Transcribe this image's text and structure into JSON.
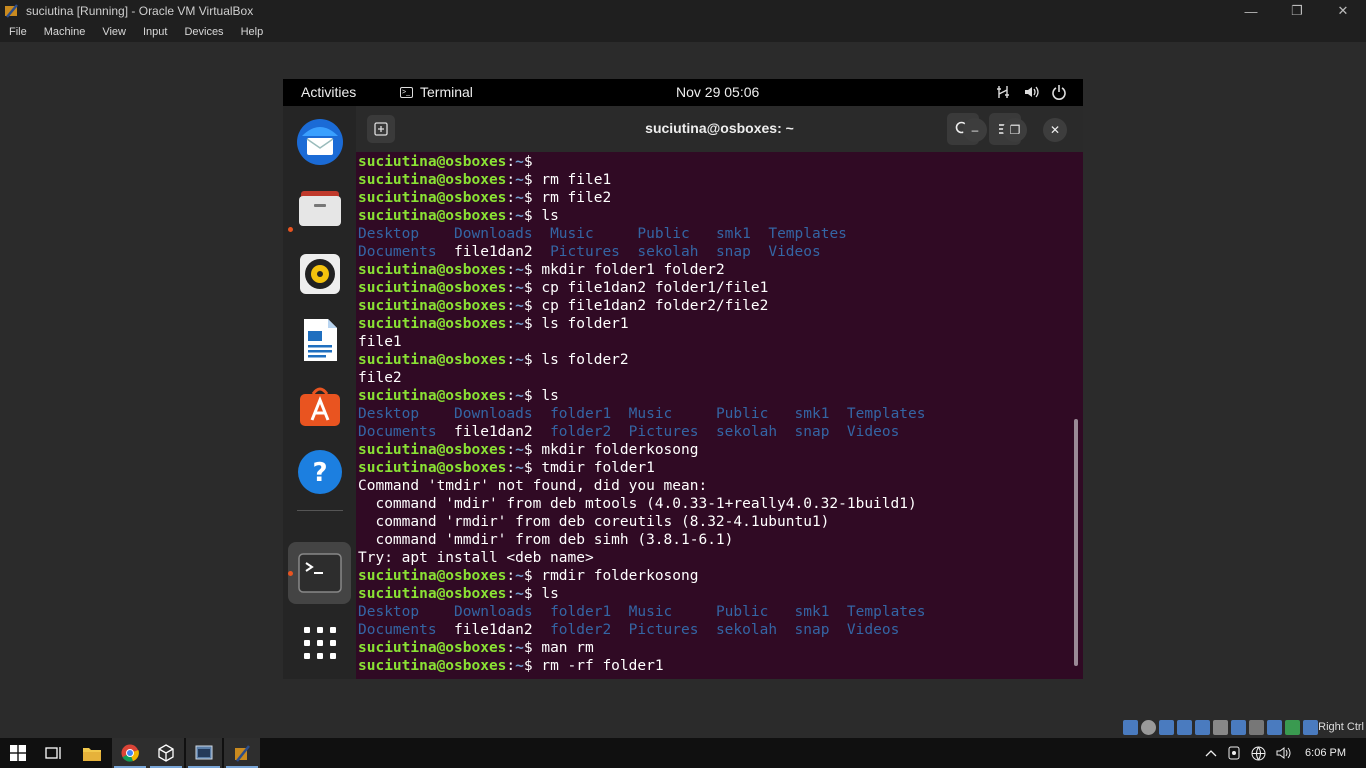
{
  "host_window": {
    "title": "suciutina [Running] - Oracle VM VirtualBox",
    "controls": [
      "minimize-icon",
      "restore-icon",
      "close-icon"
    ]
  },
  "menubar": [
    "File",
    "Machine",
    "View",
    "Input",
    "Devices",
    "Help"
  ],
  "gnome_topbar": {
    "activities": "Activities",
    "app_name": "Terminal",
    "clock": "Nov 29  05:06",
    "tray_icons": [
      "network-icon",
      "volume-icon",
      "power-icon"
    ]
  },
  "dock": {
    "items": [
      {
        "name": "thunderbird",
        "icon": "mail-client-icon"
      },
      {
        "name": "files",
        "icon": "file-manager-icon",
        "running": true
      },
      {
        "name": "rhythmbox",
        "icon": "music-player-icon"
      },
      {
        "name": "libreoffice-writer",
        "icon": "document-editor-icon"
      },
      {
        "name": "ubuntu-software",
        "icon": "app-store-icon"
      },
      {
        "name": "help",
        "icon": "help-icon"
      },
      {
        "name": "terminal",
        "icon": "terminal-icon",
        "running": true,
        "active": true
      },
      {
        "name": "show-applications",
        "icon": "app-grid-icon"
      }
    ]
  },
  "terminal": {
    "title": "suciutina@osboxes: ~",
    "prompt_user": "suciutina@osboxes",
    "prompt_path": "~",
    "lines": [
      {
        "t": "prompt",
        "cmd": ""
      },
      {
        "t": "prompt",
        "cmd": "rm file1"
      },
      {
        "t": "prompt",
        "cmd": "rm file2"
      },
      {
        "t": "prompt",
        "cmd": "ls"
      },
      {
        "t": "ls",
        "items": [
          [
            "Desktop",
            "dir"
          ],
          [
            "Downloads",
            "dir"
          ],
          [
            "Music",
            "dir"
          ],
          [
            "Public",
            "dir"
          ],
          [
            "smk1",
            "dir"
          ],
          [
            "Templates",
            "dir"
          ]
        ],
        "widths": [
          11,
          11,
          10,
          9,
          6,
          9
        ]
      },
      {
        "t": "ls",
        "items": [
          [
            "Documents",
            "dir"
          ],
          [
            "file1dan2",
            "file"
          ],
          [
            "Pictures",
            "dir"
          ],
          [
            "sekolah",
            "dir"
          ],
          [
            "snap",
            "dir"
          ],
          [
            "Videos",
            "dir"
          ]
        ],
        "widths": [
          11,
          11,
          10,
          9,
          6,
          9
        ]
      },
      {
        "t": "prompt",
        "cmd": "mkdir folder1 folder2"
      },
      {
        "t": "prompt",
        "cmd": "cp file1dan2 folder1/file1"
      },
      {
        "t": "prompt",
        "cmd": "cp file1dan2 folder2/file2"
      },
      {
        "t": "prompt",
        "cmd": "ls folder1"
      },
      {
        "t": "out",
        "text": "file1"
      },
      {
        "t": "prompt",
        "cmd": "ls folder2"
      },
      {
        "t": "out",
        "text": "file2"
      },
      {
        "t": "prompt",
        "cmd": "ls"
      },
      {
        "t": "ls",
        "items": [
          [
            "Desktop",
            "dir"
          ],
          [
            "Downloads",
            "dir"
          ],
          [
            "folder1",
            "dir"
          ],
          [
            "Music",
            "dir"
          ],
          [
            "Public",
            "dir"
          ],
          [
            "smk1",
            "dir"
          ],
          [
            "Templates",
            "dir"
          ]
        ],
        "widths": [
          11,
          11,
          9,
          10,
          9,
          6,
          9
        ]
      },
      {
        "t": "ls",
        "items": [
          [
            "Documents",
            "dir"
          ],
          [
            "file1dan2",
            "file"
          ],
          [
            "folder2",
            "dir"
          ],
          [
            "Pictures",
            "dir"
          ],
          [
            "sekolah",
            "dir"
          ],
          [
            "snap",
            "dir"
          ],
          [
            "Videos",
            "dir"
          ]
        ],
        "widths": [
          11,
          11,
          9,
          10,
          9,
          6,
          9
        ]
      },
      {
        "t": "prompt",
        "cmd": "mkdir folderkosong"
      },
      {
        "t": "prompt",
        "cmd": "tmdir folder1"
      },
      {
        "t": "out",
        "text": "Command 'tmdir' not found, did you mean:"
      },
      {
        "t": "out",
        "text": "  command 'mdir' from deb mtools (4.0.33-1+really4.0.32-1build1)"
      },
      {
        "t": "out",
        "text": "  command 'rmdir' from deb coreutils (8.32-4.1ubuntu1)"
      },
      {
        "t": "out",
        "text": "  command 'mmdir' from deb simh (3.8.1-6.1)"
      },
      {
        "t": "out",
        "text": "Try: apt install <deb name>"
      },
      {
        "t": "prompt",
        "cmd": "rmdir folderkosong"
      },
      {
        "t": "prompt",
        "cmd": "ls"
      },
      {
        "t": "ls",
        "items": [
          [
            "Desktop",
            "dir"
          ],
          [
            "Downloads",
            "dir"
          ],
          [
            "folder1",
            "dir"
          ],
          [
            "Music",
            "dir"
          ],
          [
            "Public",
            "dir"
          ],
          [
            "smk1",
            "dir"
          ],
          [
            "Templates",
            "dir"
          ]
        ],
        "widths": [
          11,
          11,
          9,
          10,
          9,
          6,
          9
        ]
      },
      {
        "t": "ls",
        "items": [
          [
            "Documents",
            "dir"
          ],
          [
            "file1dan2",
            "file"
          ],
          [
            "folder2",
            "dir"
          ],
          [
            "Pictures",
            "dir"
          ],
          [
            "sekolah",
            "dir"
          ],
          [
            "snap",
            "dir"
          ],
          [
            "Videos",
            "dir"
          ]
        ],
        "widths": [
          11,
          11,
          9,
          10,
          9,
          6,
          9
        ]
      },
      {
        "t": "prompt",
        "cmd": "man rm"
      },
      {
        "t": "prompt",
        "cmd": "rm -rf folder1"
      }
    ]
  },
  "vbox_status": {
    "host_key": "Right Ctrl"
  },
  "taskbar": {
    "items": [
      "start-icon",
      "task-view-icon",
      "file-explorer-icon",
      "chrome-icon",
      "virtualbox-icon",
      "vm-window-icon",
      "virtualbox-manager-icon"
    ],
    "time": "6:06 PM"
  },
  "colors": {
    "terminal_bg": "#300a24",
    "prompt_user": "#8ae234",
    "prompt_path": "#729fcf",
    "directory": "#3465a4",
    "accent": "#e95420"
  }
}
